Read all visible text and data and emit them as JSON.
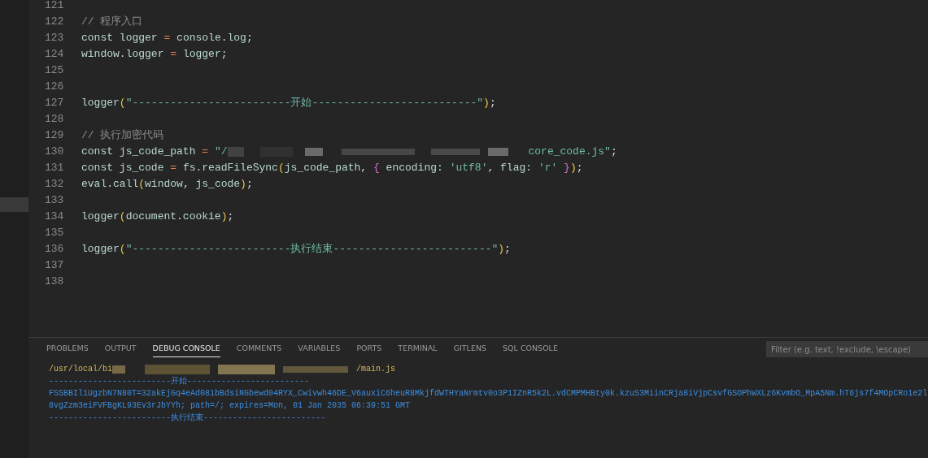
{
  "editor": {
    "lines": [
      {
        "number": "121"
      },
      {
        "number": "122",
        "segments": [
          "// 程序入口"
        ]
      },
      {
        "number": "123",
        "segments": [
          "const logger = console.log;"
        ]
      },
      {
        "number": "124",
        "segments": [
          "window.logger = logger;"
        ]
      },
      {
        "number": "125"
      },
      {
        "number": "126"
      },
      {
        "number": "127",
        "segments": [
          "logger(\"-------------------------开始--------------------------\");"
        ]
      },
      {
        "number": "128"
      },
      {
        "number": "129",
        "segments": [
          "// 执行加密代码"
        ]
      },
      {
        "number": "130",
        "segments": [
          "const js_code_path = \"/",
          "core_code.js\";"
        ]
      },
      {
        "number": "131",
        "segments": [
          "const js_code = fs.readFileSync(js_code_path, { encoding: 'utf8', flag: 'r' });"
        ]
      },
      {
        "number": "132",
        "segments": [
          "eval.call(window, js_code);"
        ]
      },
      {
        "number": "133"
      },
      {
        "number": "134",
        "segments": [
          "logger(document.cookie);"
        ]
      },
      {
        "number": "135"
      },
      {
        "number": "136",
        "segments": [
          "logger(\"-------------------------执行结束-------------------------\");"
        ]
      },
      {
        "number": "137"
      },
      {
        "number": "138"
      }
    ]
  },
  "panel": {
    "tabs": [
      {
        "label": "PROBLEMS",
        "selected": false
      },
      {
        "label": "OUTPUT",
        "selected": false
      },
      {
        "label": "DEBUG CONSOLE",
        "selected": true
      },
      {
        "label": "COMMENTS",
        "selected": false
      },
      {
        "label": "VARIABLES",
        "selected": false
      },
      {
        "label": "PORTS",
        "selected": false
      },
      {
        "label": "TERMINAL",
        "selected": false
      },
      {
        "label": "GITLENS",
        "selected": false
      },
      {
        "label": "SQL CONSOLE",
        "selected": false
      }
    ],
    "filter": {
      "placeholder": "Filter (e.g. text, !exclude, \\escape)"
    },
    "console": [
      {
        "kind": "path",
        "segments": [
          "/usr/local/bi",
          "/main.js"
        ]
      },
      {
        "kind": "output",
        "segments": [
          "-------------------------开始-------------------------"
        ]
      },
      {
        "kind": "output",
        "segments": [
          "FSSBBIl1UgzbN7N80T=32akEjGq4eAd081bBdsiNGbewd04RYX_Cwivwh46DE_V6auxiC6heuR8MkjfdWTHYaNrmtv0o3P1IZnR5k2L.vdCMPMHBty0k.kzuS3MiinCRja8iVjpCsvfGSOPhWXLz6KvmbO_MpA5Nm.hT6js7f4MOpCRo1e2l"
        ]
      },
      {
        "kind": "output",
        "segments": [
          "8vgZzm3eiFVFBgKL93Ev3rJbYYh; path=/; expires=Mon, 01 Jan 2035 06:39:51 GMT"
        ]
      },
      {
        "kind": "output",
        "segments": [
          "-------------------------执行结束-------------------------"
        ]
      }
    ]
  }
}
